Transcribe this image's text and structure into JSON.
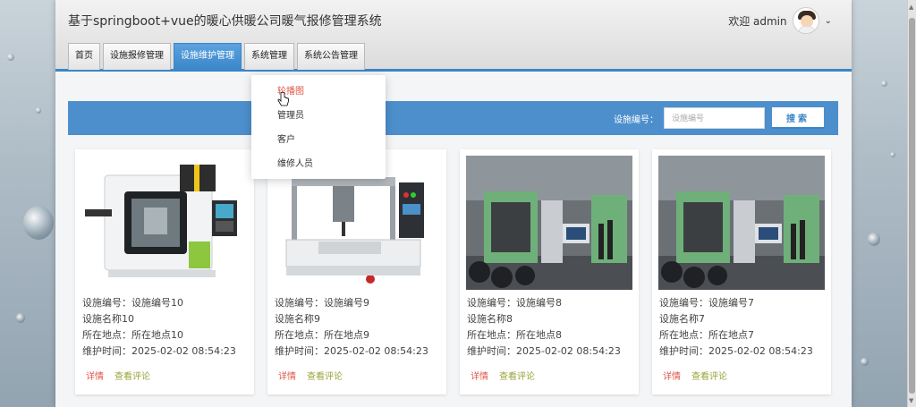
{
  "header": {
    "title": "基于springboot+vue的暖心供暖公司暖气报修管理系统",
    "welcome": "欢迎 admin"
  },
  "nav": {
    "tabs": [
      {
        "label": "首页",
        "active": false
      },
      {
        "label": "设施报修管理",
        "active": false
      },
      {
        "label": "设施维护管理",
        "active": true
      },
      {
        "label": "系统管理",
        "active": false
      },
      {
        "label": "系统公告管理",
        "active": false
      }
    ]
  },
  "dropdown": {
    "items": [
      "轮播图",
      "管理员",
      "客户",
      "维修人员"
    ],
    "hovered": 0
  },
  "search": {
    "label": "设施编号：",
    "placeholder": "设施编号",
    "button": "搜索"
  },
  "cards": [
    {
      "code": "设施编号：设施编号10",
      "name": "设施名称10",
      "location": "所在地点：所在地点10",
      "time": "维护时间：2025-02-02 08:54:23",
      "detail": "详情",
      "comment": "查看评论",
      "image": "cnc-machine"
    },
    {
      "code": "设施编号：设施编号9",
      "name": "设施名称9",
      "location": "所在地点：所在地点9",
      "time": "维护时间：2025-02-02 08:54:23",
      "detail": "详情",
      "comment": "查看评论",
      "image": "dispensing-robot"
    },
    {
      "code": "设施编号：设施编号8",
      "name": "设施名称8",
      "location": "所在地点：所在地点8",
      "time": "维护时间：2025-02-02 08:54:23",
      "detail": "详情",
      "comment": "查看评论",
      "image": "factory-line"
    },
    {
      "code": "设施编号：设施编号7",
      "name": "设施名称7",
      "location": "所在地点：所在地点7",
      "time": "维护时间：2025-02-02 08:54:23",
      "detail": "详情",
      "comment": "查看评论",
      "image": "factory-line"
    }
  ],
  "colors": {
    "accent": "#3a86c8",
    "searchbar": "#4d8fcc",
    "detail": "#e0574b",
    "comment": "#9aa33a"
  }
}
